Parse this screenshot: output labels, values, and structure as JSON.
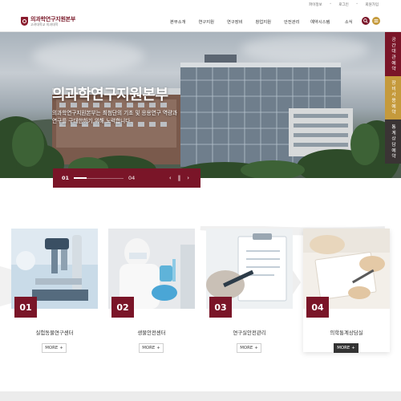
{
  "util": {
    "links": [
      "파이정보",
      "로그인",
      "회원가입"
    ]
  },
  "header": {
    "logo_title": "의과학연구지원본부",
    "logo_sub": "고려대학교 의과대학",
    "nav": [
      "본부소개",
      "연구지원",
      "연구장비",
      "창업지원",
      "안전관리",
      "예약시스템",
      "소식"
    ]
  },
  "hero": {
    "title": "의과학연구지원본부",
    "desc_lines": [
      "의과학연구지원본부는 최첨단의 기초 및 응용연구 역량과",
      "연구를 구대한하기 위해 노력합니다."
    ],
    "slider": {
      "current": "01",
      "total": "04",
      "progress": 0.25,
      "prev": "‹",
      "pause": "‖",
      "next": "›"
    }
  },
  "quick_links": [
    "공간대관예약",
    "장비사용예약",
    "통계상담예약"
  ],
  "cards": [
    {
      "num": "01",
      "title": "실험동물연구센터",
      "more": "MORE",
      "active": false
    },
    {
      "num": "02",
      "title": "생물안전센터",
      "more": "MORE",
      "active": false
    },
    {
      "num": "03",
      "title": "연구실안전관리",
      "more": "MORE",
      "active": false
    },
    {
      "num": "04",
      "title": "의학통계상담실",
      "more": "MORE",
      "active": true
    }
  ],
  "colors": {
    "brand": "#7a1528",
    "gold": "#c59a3c",
    "dark": "#3a3434"
  },
  "icons": {
    "search": "search-icon",
    "menu": "menu-icon",
    "plus": "plus-icon"
  }
}
